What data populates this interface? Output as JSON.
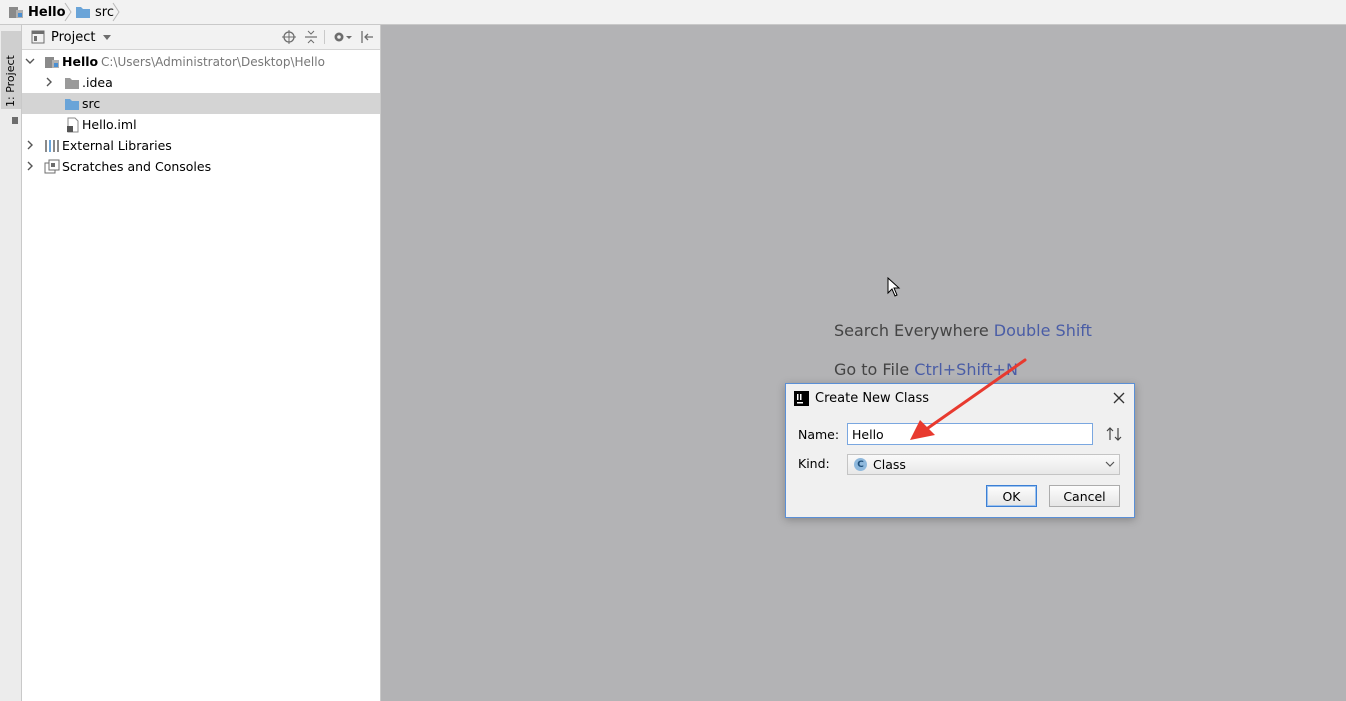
{
  "breadcrumb": {
    "items": [
      {
        "label": "Hello",
        "icon": "module-icon"
      },
      {
        "label": "src",
        "icon": "folder-icon"
      }
    ]
  },
  "toolstrip": {
    "project_tab": "1: Project"
  },
  "project_panel": {
    "header": {
      "view_label": "Project"
    },
    "tree": {
      "root": {
        "label": "Hello",
        "path": "C:\\Users\\Administrator\\Desktop\\Hello"
      },
      "idea": {
        "label": ".idea"
      },
      "src": {
        "label": "src"
      },
      "iml": {
        "label": "Hello.iml"
      },
      "external_libraries": {
        "label": "External Libraries"
      },
      "scratches": {
        "label": "Scratches and Consoles"
      }
    }
  },
  "editor": {
    "hints": [
      {
        "text": "Search Everywhere",
        "shortcut": "Double Shift"
      },
      {
        "text": "Go to File",
        "shortcut": "Ctrl+Shift+N"
      }
    ]
  },
  "dialog": {
    "title": "Create New Class",
    "name_label": "Name:",
    "name_value": "Hello",
    "kind_label": "Kind:",
    "kind_value": "Class",
    "kind_badge": "C",
    "ok_label": "OK",
    "cancel_label": "Cancel"
  },
  "colors": {
    "editor_bg": "#b3b3b5",
    "shortcut_text": "#4a5da6",
    "selection_bg": "#d4d4d4",
    "folder": "#6aa4d8",
    "annotation_arrow": "#e83a2f"
  }
}
